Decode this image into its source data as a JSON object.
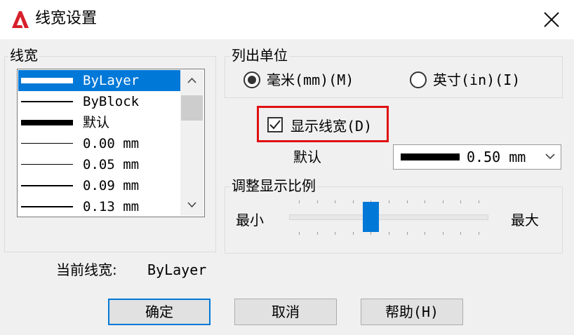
{
  "window": {
    "title": "线宽设置"
  },
  "lineweight_group": {
    "legend": "线宽",
    "items": [
      {
        "label": "ByLayer",
        "selected": true
      },
      {
        "label": "ByBlock",
        "selected": false
      },
      {
        "label": "默认",
        "selected": false
      },
      {
        "label": "0.00 mm",
        "selected": false
      },
      {
        "label": "0.05 mm",
        "selected": false
      },
      {
        "label": "0.09 mm",
        "selected": false
      },
      {
        "label": "0.13 mm",
        "selected": false
      }
    ]
  },
  "units_group": {
    "legend": "列出单位",
    "options": [
      {
        "label": "毫米(mm)(M)",
        "checked": true
      },
      {
        "label": "英寸(in)(I)",
        "checked": false
      }
    ]
  },
  "display_lineweight": {
    "label": "显示线宽(D)",
    "checked": true
  },
  "default": {
    "label": "默认",
    "value": "0.50 mm"
  },
  "scale_group": {
    "legend": "调整显示比例",
    "min_label": "最小",
    "max_label": "最大",
    "level": 0.4
  },
  "current": {
    "label": "当前线宽:",
    "value": "ByLayer"
  },
  "buttons": {
    "ok": "确定",
    "cancel": "取消",
    "help": "帮助(H)"
  },
  "colors": {
    "accent": "#0078d7",
    "highlight": "#e01010",
    "app_logo": "#d6202a"
  },
  "icons": {
    "app": "autocad-logo-icon",
    "close": "close-icon"
  }
}
